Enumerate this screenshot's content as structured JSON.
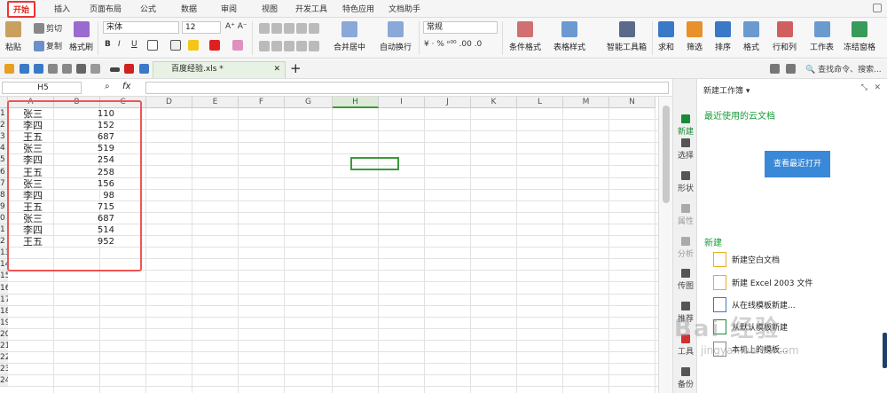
{
  "menu": [
    "开始",
    "插入",
    "页面布局",
    "公式",
    "数据",
    "审阅",
    "视图",
    "开发工具",
    "特色应用",
    "文档助手"
  ],
  "ribbon": {
    "paste": "粘贴",
    "cut": "剪切",
    "copy": "复制",
    "format_painter": "格式刷",
    "font_name": "宋体",
    "font_size": "12",
    "bold": "B",
    "italic": "I",
    "underline": "U",
    "merge_center": "合并居中",
    "wrap": "自动换行",
    "number_format": "常规",
    "cond_format": "条件格式",
    "table_style": "表格样式",
    "smart_toolbox": "智能工具箱",
    "sum": "求和",
    "filter": "筛选",
    "sort": "排序",
    "format": "格式",
    "rows_cols": "行和列",
    "worksheet": "工作表",
    "freeze": "冻结窗格"
  },
  "tab": {
    "filename": "百度经验.xls *"
  },
  "search_placeholder": "查找命令、搜索...",
  "namebox": "H5",
  "fx": "fx",
  "columns": [
    "A",
    "B",
    "C",
    "D",
    "E",
    "F",
    "G",
    "H",
    "I",
    "J",
    "K",
    "L",
    "M",
    "N"
  ],
  "rows": [
    {
      "n": "1",
      "a": "张三",
      "b": "110"
    },
    {
      "n": "2",
      "a": "李四",
      "b": "152"
    },
    {
      "n": "3",
      "a": "王五",
      "b": "687"
    },
    {
      "n": "4",
      "a": "张三",
      "b": "519"
    },
    {
      "n": "5",
      "a": "李四",
      "b": "254"
    },
    {
      "n": "6",
      "a": "王五",
      "b": "258"
    },
    {
      "n": "7",
      "a": "张三",
      "b": "156"
    },
    {
      "n": "8",
      "a": "李四",
      "b": "98"
    },
    {
      "n": "9",
      "a": "王五",
      "b": "715"
    },
    {
      "n": "0",
      "a": "张三",
      "b": "687"
    },
    {
      "n": "1",
      "a": "李四",
      "b": "514"
    },
    {
      "n": "2",
      "a": "王五",
      "b": "952"
    },
    {
      "n": "13",
      "a": "",
      "b": ""
    },
    {
      "n": "14",
      "a": "",
      "b": ""
    },
    {
      "n": "15",
      "a": "",
      "b": ""
    },
    {
      "n": "16",
      "a": "",
      "b": ""
    },
    {
      "n": "17",
      "a": "",
      "b": ""
    },
    {
      "n": "18",
      "a": "",
      "b": ""
    },
    {
      "n": "19",
      "a": "",
      "b": ""
    },
    {
      "n": "20",
      "a": "",
      "b": ""
    },
    {
      "n": "21",
      "a": "",
      "b": ""
    },
    {
      "n": "22",
      "a": "",
      "b": ""
    },
    {
      "n": "23",
      "a": "",
      "b": ""
    },
    {
      "n": "24",
      "a": "",
      "b": ""
    }
  ],
  "side_tabs": [
    "新建",
    "选择",
    "形状",
    "属性",
    "分析",
    "传图",
    "推荐",
    "工具",
    "备份"
  ],
  "panel": {
    "title": "新建工作簿",
    "recent": "最近使用的云文档",
    "open_recent": "查看最近打开",
    "new_section": "新建",
    "items": [
      "新建空白文档",
      "新建 Excel 2003 文件",
      "从在线模板新建...",
      "从默认模板新建",
      "本机上的模板..."
    ]
  },
  "watermark": "Bai 经验",
  "watermark_url": "jingyan.baidu.com"
}
